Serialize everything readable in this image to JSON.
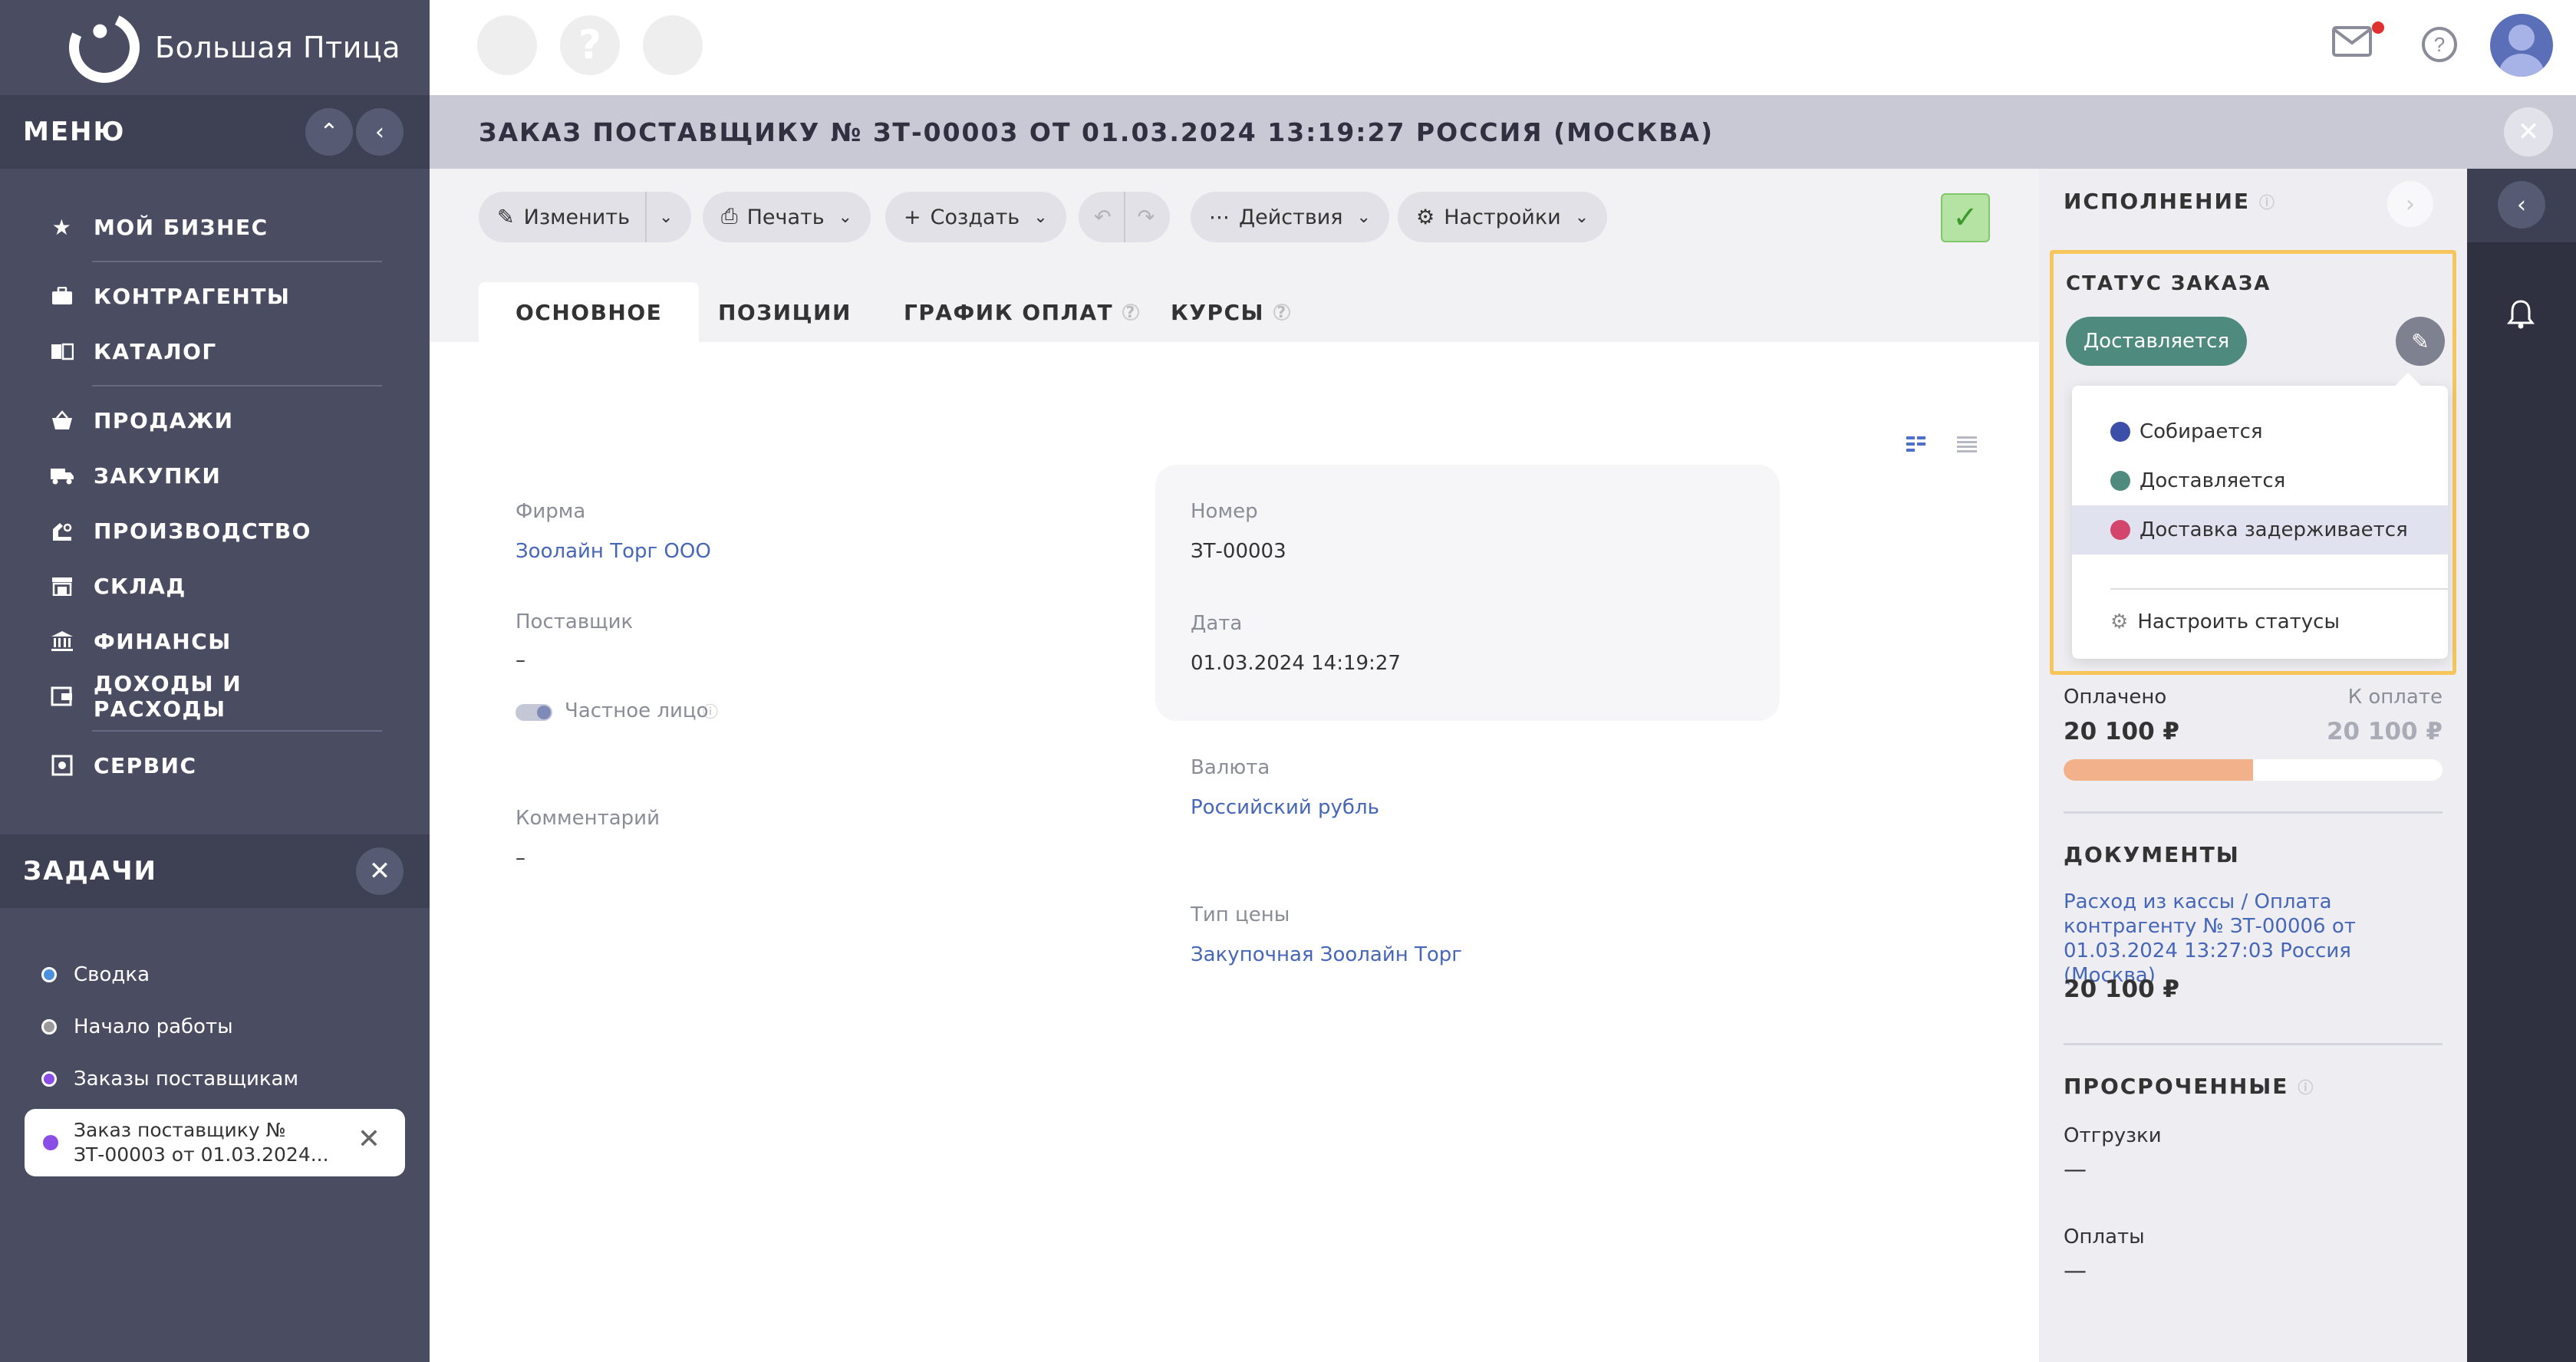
{
  "brand": {
    "name": "Большая Птица"
  },
  "menu": {
    "title": "МЕНЮ",
    "items": [
      {
        "label": "МОЙ БИЗНЕС",
        "icon": "star-icon"
      },
      {
        "label": "КОНТРАГЕНТЫ",
        "icon": "briefcase-icon"
      },
      {
        "label": "КАТАЛОГ",
        "icon": "book-icon"
      },
      {
        "label": "ПРОДАЖИ",
        "icon": "basket-icon"
      },
      {
        "label": "ЗАКУПКИ",
        "icon": "truck-icon"
      },
      {
        "label": "ПРОИЗВОДСТВО",
        "icon": "factory-icon"
      },
      {
        "label": "СКЛАД",
        "icon": "warehouse-icon"
      },
      {
        "label": "ФИНАНСЫ",
        "icon": "bank-icon"
      },
      {
        "label": "ДОХОДЫ И РАСХОДЫ",
        "icon": "wallet-icon"
      },
      {
        "label": "СЕРВИС",
        "icon": "service-icon"
      }
    ]
  },
  "tasks": {
    "title": "ЗАДАЧИ",
    "items": [
      {
        "label": "Сводка",
        "color": "#4a8fe0"
      },
      {
        "label": "Начало работы",
        "color": "#9a9a9a"
      },
      {
        "label": "Заказы поставщикам",
        "color": "#8a4ee6"
      }
    ],
    "active": {
      "line1": "Заказ поставщику №",
      "line2": "ЗТ-00003 от 01.03.2024..."
    }
  },
  "page": {
    "title": "ЗАКАЗ ПОСТАВЩИКУ № ЗТ-00003 ОТ 01.03.2024 13:19:27 РОССИЯ (МОСКВА)"
  },
  "toolbar": {
    "edit": "Изменить",
    "print": "Печать",
    "create": "Создать",
    "actions": "Действия",
    "settings": "Настройки"
  },
  "tabs": [
    {
      "label": "ОСНОВНОЕ"
    },
    {
      "label": "ПОЗИЦИИ"
    },
    {
      "label": "ГРАФИК ОПЛАТ"
    },
    {
      "label": "КУРСЫ"
    }
  ],
  "form": {
    "firm_label": "Фирма",
    "firm_value": "Зоолайн Торг ООО",
    "supplier_label": "Поставщик",
    "supplier_value": "–",
    "private_label": "Частное лицо",
    "comment_label": "Комментарий",
    "comment_value": "–",
    "number_label": "Номер",
    "number_value": "ЗТ-00003",
    "date_label": "Дата",
    "date_value": "01.03.2024 14:19:27",
    "currency_label": "Валюта",
    "currency_value": "Российский рубль",
    "price_type_label": "Тип цены",
    "price_type_value": "Закупочная Зоолайн Торг"
  },
  "execution": {
    "title": "ИСПОЛНЕНИЕ",
    "status_title": "СТАТУС ЗАКАЗА",
    "current_status": "Доставляется",
    "status_options": [
      {
        "label": "Собирается",
        "color": "#3b4fa8"
      },
      {
        "label": "Доставляется",
        "color": "#4e8b7e"
      },
      {
        "label": "Доставка задерживается",
        "color": "#d3456a"
      }
    ],
    "configure_label": "Настроить статусы",
    "paid_label": "Оплачено",
    "to_pay_label": "К оплате",
    "paid_value": "20 100 ₽",
    "to_pay_value": "20 100 ₽",
    "paid_progress": 0.5,
    "documents_title": "ДОКУМЕНТЫ",
    "document_link": "Расход из кассы / Оплата контрагенту № ЗТ-00006 от 01.03.2024 13:27:03 Россия (Москва)",
    "document_amount": "20 100 ₽",
    "overdue_title": "ПРОСРОЧЕННЫЕ",
    "shipments_label": "Отгрузки",
    "shipments_value": "—",
    "payments_label": "Оплаты",
    "payments_value": "—"
  }
}
